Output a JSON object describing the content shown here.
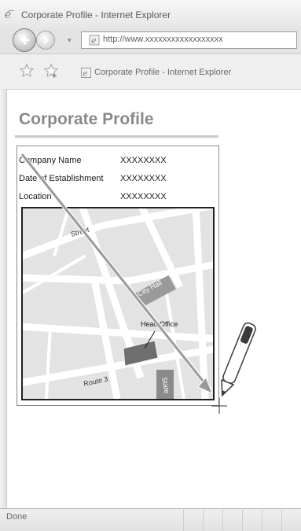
{
  "window": {
    "title": "Corporate Profile - Internet Explorer"
  },
  "address_bar": {
    "url": "http://www.xxxxxxxxxxxxxxxxxx"
  },
  "tab": {
    "title": "Corporate Profile - Internet Explorer"
  },
  "page": {
    "heading": "Corporate Profile",
    "info_rows": [
      {
        "label": "Company Name",
        "value": "XXXXXXXX"
      },
      {
        "label": "Date of Establishment",
        "value": "XXXXXXXX"
      },
      {
        "label": "Location",
        "value": "XXXXXXXX"
      }
    ],
    "map": {
      "labels": {
        "street": "Street",
        "city_hall": "City Hall",
        "head_office": "Head Office",
        "route": "Route 3",
        "state": "State"
      }
    }
  },
  "status_bar": {
    "text": "Done"
  },
  "icons": {
    "ie_logo": "ie-logo-icon",
    "back": "back-arrow-icon",
    "forward": "forward-arrow-icon",
    "favorites": "star-icon",
    "add_favorites": "add-star-icon",
    "page_icon": "ie-page-icon",
    "pen": "pen-icon"
  },
  "colors": {
    "heading": "#8a8a8a",
    "map_building": "#6e6e6e",
    "arrow": "#9a9a9a"
  }
}
